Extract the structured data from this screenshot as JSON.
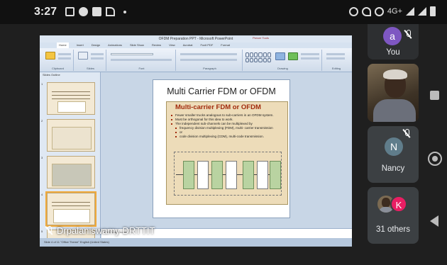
{
  "status_bar": {
    "time": "3:27",
    "network": "4G+",
    "icons": [
      "screen-record-icon",
      "facebook-icon",
      "youtube-icon",
      "app-icon",
      "alarm-icon",
      "wifi-calling-icon",
      "hotspot-icon",
      "signal-icon",
      "signal-icon",
      "battery-icon"
    ]
  },
  "presentation": {
    "presenter_name": "Drpalaniswamy DRTTIT",
    "ppt": {
      "window_title": "OFDM Preparation PPT - Microsoft PowerPoint",
      "contextual_tab": "Picture Tools",
      "menu": [
        "Home",
        "Insert",
        "Design",
        "Animations",
        "Slide Show",
        "Review",
        "View",
        "Acrobat",
        "Foxit PDF",
        "Format"
      ],
      "ribbon_groups": [
        "Clipboard",
        "Slides",
        "Font",
        "Paragraph",
        "Drawing",
        "Editing"
      ],
      "thumb_tabs": "Slides   Outline",
      "thumbnails": [
        {
          "num": "1",
          "title": ""
        },
        {
          "num": "2",
          "title": ""
        },
        {
          "num": "3",
          "title": ""
        },
        {
          "num": "4",
          "title": ""
        },
        {
          "num": "5",
          "title": ""
        }
      ],
      "slide": {
        "title": "Multi Carrier FDM or OFDM",
        "picture": {
          "heading": "Multi-carrier FDM or OFDM",
          "bullets": [
            {
              "level": 1,
              "text": "Fewer smaller trucks analogous to sub-carriers in an OFDM system."
            },
            {
              "level": 1,
              "text": "Must be orthogonal for this idea to work."
            },
            {
              "level": 1,
              "text": "The independent sub-channels can be multiplexed by"
            },
            {
              "level": 2,
              "text": "frequency division multiplexing (FDM), multi- carrier transmission"
            },
            {
              "level": 2,
              "text": "or"
            },
            {
              "level": 2,
              "text": "code division multiplexing (CDM), multi-code transmission."
            }
          ]
        }
      },
      "notes_placeholder": "Click to add notes",
      "status_text": "Slide 4 of 11   \"Office Theme\"   English (United States)"
    }
  },
  "participants": [
    {
      "label": "You",
      "initial": "a",
      "muted": true,
      "color": "#7e57c2"
    },
    {
      "label": "",
      "video": true
    },
    {
      "label": "Nancy",
      "initial": "N",
      "muted": true,
      "color": "#607d8b"
    },
    {
      "label": "31 others",
      "initial": "K",
      "color": "#e91e63"
    }
  ]
}
